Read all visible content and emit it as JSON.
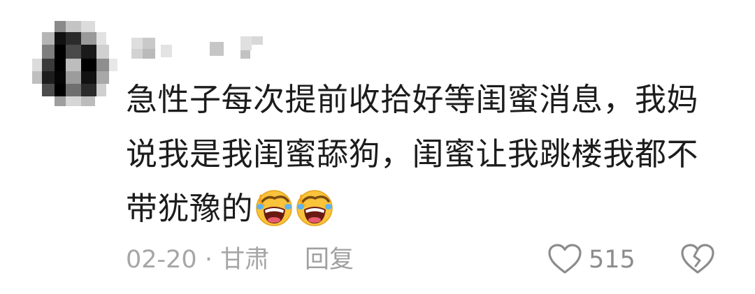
{
  "comment": {
    "avatar": "pixelated-avatar",
    "username": "",
    "text_line_1": "急性子每次提前收拾好等闺蜜消息，我妈",
    "text_line_2": "说我是我闺蜜舔狗，闺蜜让我跳楼我都不",
    "text_line_3": "带犹豫的",
    "emojis": [
      "rofl-icon",
      "rofl-icon"
    ],
    "date": "02-20",
    "separator": " · ",
    "location": "甘肃",
    "reply_label": "回复",
    "like_icon": "heart-icon",
    "like_count": "515",
    "dislike_icon": "broken-heart-icon"
  },
  "colors": {
    "text": "#1c1c1c",
    "meta": "#a6a6a6",
    "icon": "#8c8c8c",
    "emoji_face": "#f9c33b"
  }
}
